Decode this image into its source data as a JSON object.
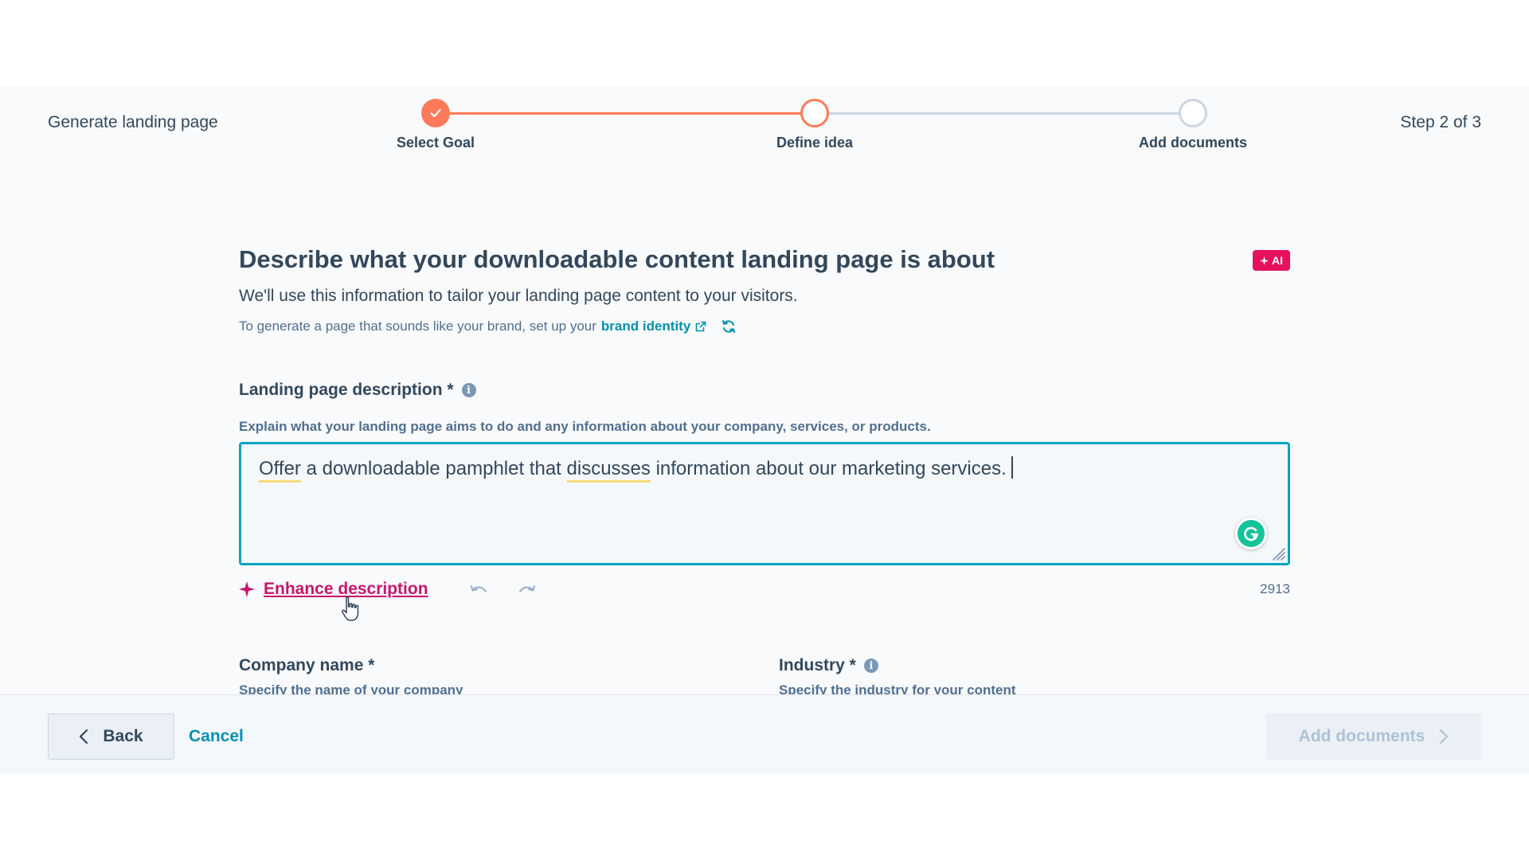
{
  "header": {
    "title": "Generate landing page",
    "step_count": "Step 2 of 3"
  },
  "stepper": {
    "steps": [
      {
        "label": "Select Goal",
        "state": "complete"
      },
      {
        "label": "Define idea",
        "state": "current"
      },
      {
        "label": "Add documents",
        "state": "upcoming"
      }
    ]
  },
  "main": {
    "title": "Describe what your downloadable content landing page is about",
    "ai_badge": "AI",
    "subtitle": "We'll use this information to tailor your landing page content to your visitors.",
    "brand_prefix": "To generate a page that sounds like your brand, set up your",
    "brand_link": "brand identity"
  },
  "description_field": {
    "label": "Landing page description *",
    "help": "Explain what your landing page aims to do and any information about your company, services, or products.",
    "value_parts": [
      "Offer",
      "a downloadable pamphlet that",
      "discusses",
      "information about our marketing services."
    ],
    "enhance_label": "Enhance description",
    "char_count": "2913"
  },
  "company_field": {
    "label": "Company name *",
    "help": "Specify the name of your company"
  },
  "industry_field": {
    "label": "Industry *",
    "help": "Specify the industry for your content"
  },
  "footer": {
    "back_label": "Back",
    "cancel_label": "Cancel",
    "next_label": "Add documents"
  },
  "colors": {
    "accent_orange": "#ff7a59",
    "teal": "#00a4bd",
    "link": "#0091ae",
    "ai_pink": "#e5115f",
    "enhance_magenta": "#c6166e"
  },
  "icons": [
    "check-icon",
    "external-link-icon",
    "refresh-icon",
    "info-icon",
    "grammarly-icon",
    "sparkle-icon",
    "undo-icon",
    "redo-icon",
    "chevron-left-icon",
    "chevron-right-icon",
    "pointer-cursor-icon"
  ]
}
